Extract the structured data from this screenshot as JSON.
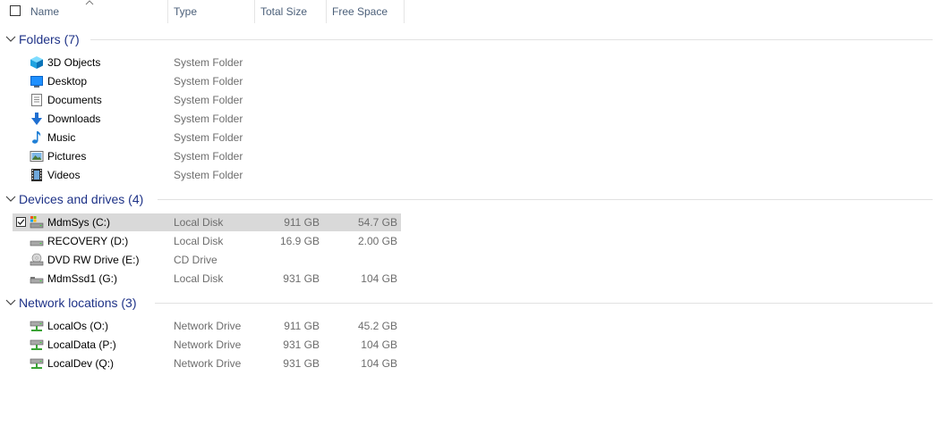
{
  "header": {
    "columns": {
      "name": "Name",
      "type": "Type",
      "total_size": "Total Size",
      "free_space": "Free Space"
    },
    "sort_indicator": "sort-ascending-icon"
  },
  "groups": {
    "folders": {
      "title": "Folders (7)",
      "items": [
        {
          "name": "3D Objects",
          "type": "System Folder",
          "icon": "3d-objects-icon"
        },
        {
          "name": "Desktop",
          "type": "System Folder",
          "icon": "desktop-icon"
        },
        {
          "name": "Documents",
          "type": "System Folder",
          "icon": "documents-icon"
        },
        {
          "name": "Downloads",
          "type": "System Folder",
          "icon": "downloads-icon"
        },
        {
          "name": "Music",
          "type": "System Folder",
          "icon": "music-icon"
        },
        {
          "name": "Pictures",
          "type": "System Folder",
          "icon": "pictures-icon"
        },
        {
          "name": "Videos",
          "type": "System Folder",
          "icon": "videos-icon"
        }
      ]
    },
    "devices": {
      "title": "Devices and drives (4)",
      "items": [
        {
          "name": "MdmSys (C:)",
          "type": "Local Disk",
          "total": "911 GB",
          "free": "54.7 GB",
          "icon": "system-drive-icon",
          "selected": true
        },
        {
          "name": "RECOVERY (D:)",
          "type": "Local Disk",
          "total": "16.9 GB",
          "free": "2.00 GB",
          "icon": "hard-drive-icon"
        },
        {
          "name": "DVD RW Drive (E:)",
          "type": "CD Drive",
          "total": "",
          "free": "",
          "icon": "dvd-drive-icon"
        },
        {
          "name": "MdmSsd1 (G:)",
          "type": "Local Disk",
          "total": "931 GB",
          "free": "104 GB",
          "icon": "hard-drive-icon"
        }
      ]
    },
    "network": {
      "title": "Network locations (3)",
      "items": [
        {
          "name": "LocalOs (O:)",
          "type": "Network Drive",
          "total": "911 GB",
          "free": "45.2 GB",
          "icon": "network-drive-icon"
        },
        {
          "name": "LocalData (P:)",
          "type": "Network Drive",
          "total": "931 GB",
          "free": "104 GB",
          "icon": "network-drive-icon"
        },
        {
          "name": "LocalDev (Q:)",
          "type": "Network Drive",
          "total": "931 GB",
          "free": "104 GB",
          "icon": "network-drive-icon"
        }
      ]
    }
  },
  "colors": {
    "group_header": "#1e3287",
    "column_header": "#4c607a",
    "secondary_text": "#6d6d6d",
    "selection": "#d9d9d9"
  }
}
